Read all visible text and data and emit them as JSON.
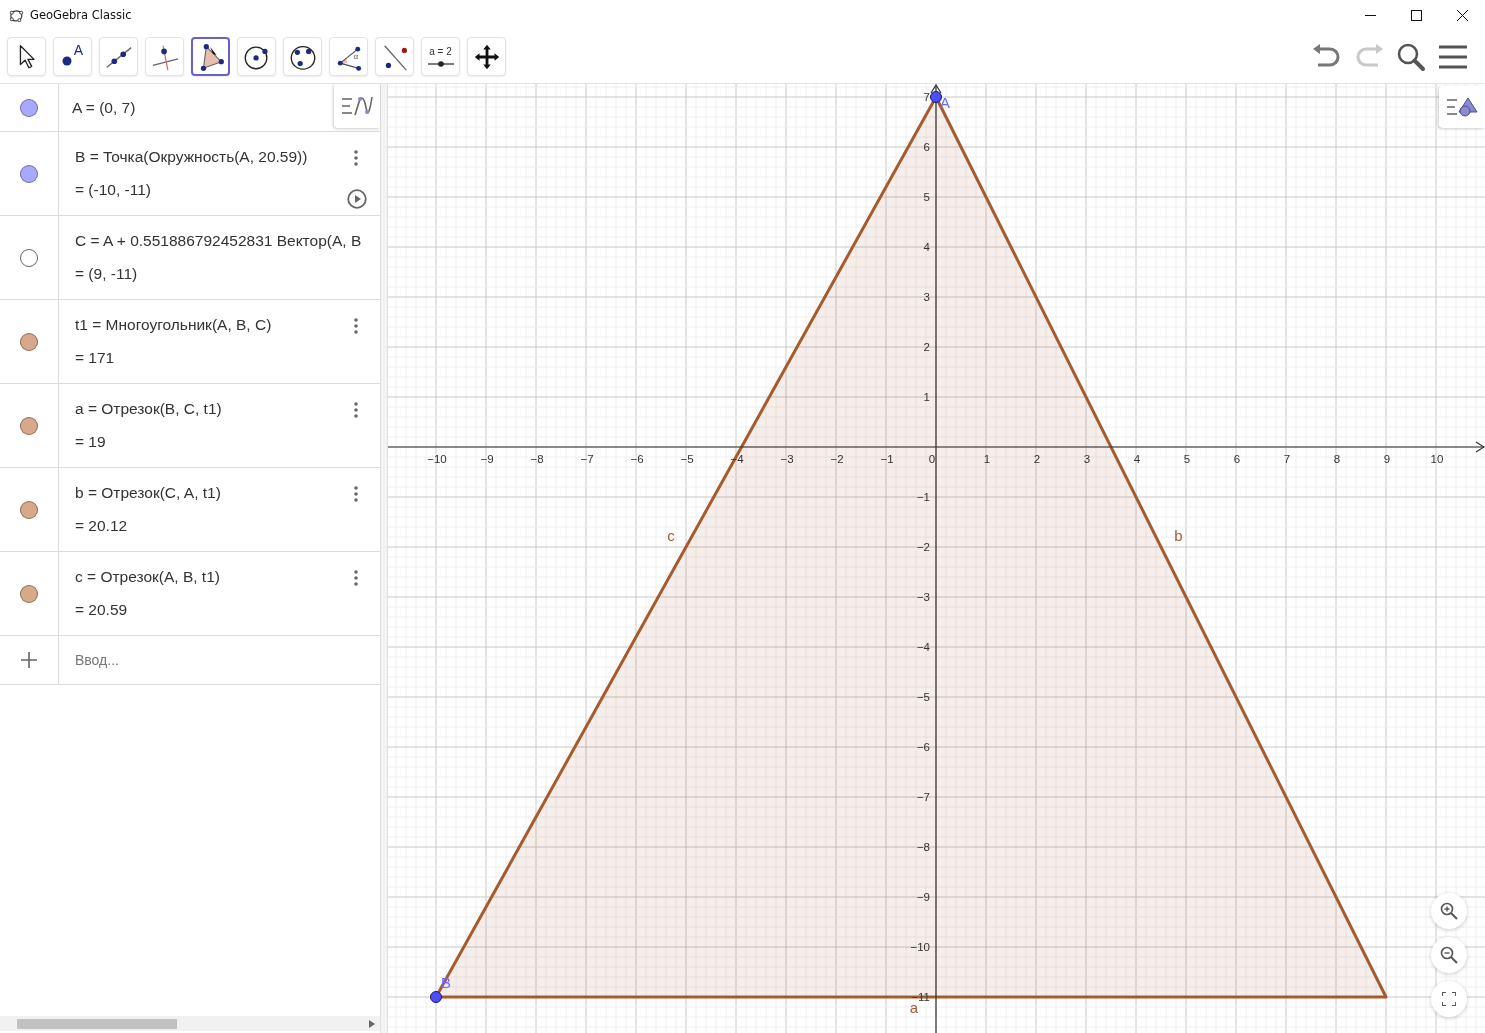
{
  "window": {
    "title": "GeoGebra Classic"
  },
  "toolbar": {
    "tools": [
      {
        "kind": "move",
        "selected": false
      },
      {
        "kind": "point",
        "label": "A",
        "selected": false
      },
      {
        "kind": "line",
        "selected": false
      },
      {
        "kind": "perpendicular",
        "selected": false
      },
      {
        "kind": "polygon",
        "selected": true
      },
      {
        "kind": "circle",
        "selected": false
      },
      {
        "kind": "conic",
        "selected": false
      },
      {
        "kind": "angle",
        "label": "α",
        "selected": false
      },
      {
        "kind": "reflect",
        "selected": false
      },
      {
        "kind": "slider",
        "label": "a = 2",
        "selected": false
      },
      {
        "kind": "move-view",
        "selected": false
      }
    ],
    "undo": {
      "disabled": false
    },
    "redo": {
      "disabled": true
    }
  },
  "algebra": {
    "items": [
      {
        "definition": "A = (0, 7)",
        "color": "#a8a8ff",
        "visible": true,
        "menu": false,
        "play": false
      },
      {
        "definition": "B = Точка(Окружность(A, 20.59))",
        "value": "= (-10, -11)",
        "color": "#a8a8ff",
        "visible": true,
        "menu": true,
        "play": true
      },
      {
        "definition": "C = A + 0.551886792452831 Вектор(A, B",
        "value": "= (9, -11)",
        "color": "#666666",
        "visible": false,
        "menu": false,
        "play": false
      },
      {
        "definition": "t1 = Многоугольник(A, B, C)",
        "value": "= 171",
        "color": "#d7a88a",
        "visible": true,
        "menu": true,
        "play": false
      },
      {
        "definition": "a = Отрезок(B, C, t1)",
        "value": "= 19",
        "color": "#d7a88a",
        "visible": true,
        "menu": true,
        "play": false
      },
      {
        "definition": "b = Отрезок(C, A, t1)",
        "value": "= 20.12",
        "color": "#d7a88a",
        "visible": true,
        "menu": true,
        "play": false
      },
      {
        "definition": "c = Отрезок(A, B, t1)",
        "value": "= 20.59",
        "color": "#d7a88a",
        "visible": true,
        "menu": true,
        "play": false
      }
    ],
    "input": {
      "placeholder": "Ввод..."
    }
  },
  "graphics": {
    "chart_data": {
      "type": "area",
      "x": [
        0,
        -10,
        9,
        0
      ],
      "series": [
        {
          "color": "#a65b2f",
          "values": [
            7,
            -11,
            -11,
            7
          ]
        }
      ],
      "grid": true,
      "xlim": [
        -10.96,
        10.98
      ],
      "ylim": [
        -11.72,
        7.26
      ],
      "xticks": [
        {
          "value": -10,
          "label": "−10"
        },
        {
          "value": -9,
          "label": "−9"
        },
        {
          "value": -8,
          "label": "−8"
        },
        {
          "value": -7,
          "label": "−7"
        },
        {
          "value": -6,
          "label": "−6"
        },
        {
          "value": -5,
          "label": "−5"
        },
        {
          "value": -4,
          "label": "−4"
        },
        {
          "value": -3,
          "label": "−3"
        },
        {
          "value": -2,
          "label": "−2"
        },
        {
          "value": -1,
          "label": "−1"
        },
        0,
        1,
        2,
        3,
        4,
        5,
        6,
        7,
        8,
        9,
        10
      ],
      "yticks": [
        7,
        6,
        5,
        4,
        3,
        2,
        1,
        {
          "value": -1,
          "label": "−1"
        },
        {
          "value": -2,
          "label": "−2"
        },
        {
          "value": -3,
          "label": "−3"
        },
        {
          "value": -4,
          "label": "−4"
        },
        {
          "value": -5,
          "label": "−5"
        },
        {
          "value": -6,
          "label": "−6"
        },
        {
          "value": -7,
          "label": "−7"
        },
        {
          "value": -8,
          "label": "−8"
        },
        {
          "value": -9,
          "label": "−9"
        },
        {
          "value": -10,
          "label": "−10"
        },
        {
          "value": -11,
          "label": "−11"
        }
      ],
      "annotations": [
        "A",
        "B",
        "c",
        "b",
        "a"
      ]
    }
  }
}
